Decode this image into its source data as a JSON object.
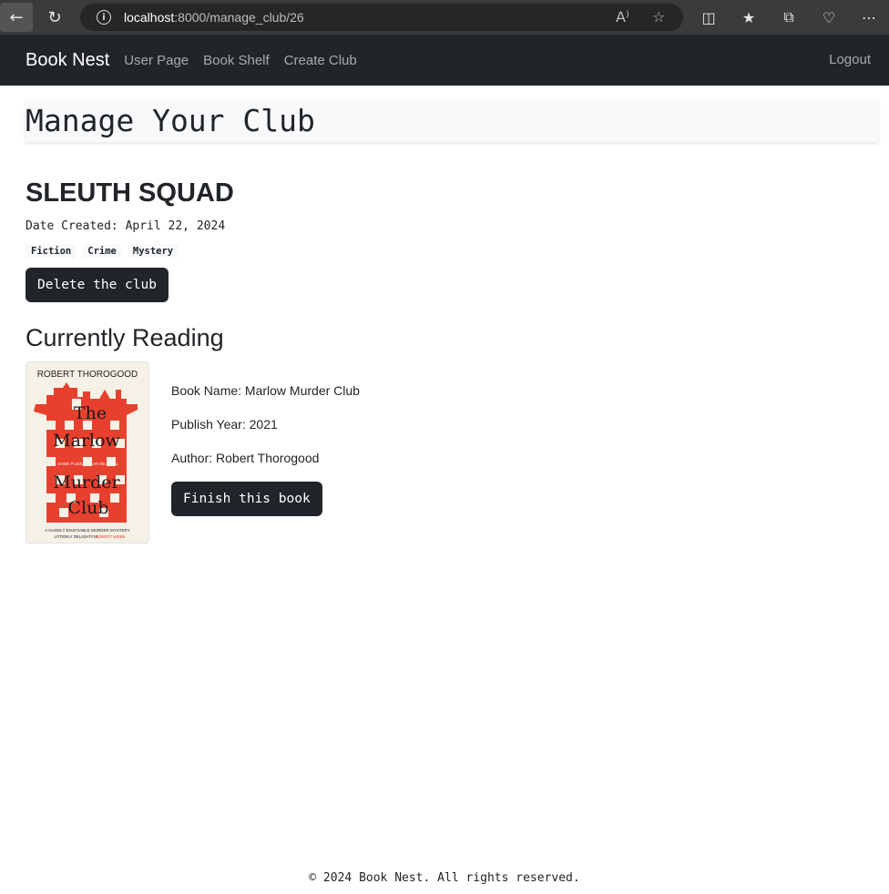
{
  "browser": {
    "url_host": "localhost",
    "url_path": ":8000/manage_club/26"
  },
  "navbar": {
    "brand": "Book Nest",
    "links": [
      "User Page",
      "Book Shelf",
      "Create Club"
    ],
    "logout": "Logout"
  },
  "page": {
    "title": "Manage Your Club"
  },
  "club": {
    "name": "SLEUTH SQUAD",
    "date_created": "Date Created: April 22, 2024",
    "tags": [
      "Fiction",
      "Crime",
      "Mystery"
    ],
    "delete_label": "Delete the club"
  },
  "reading": {
    "section_title": "Currently Reading",
    "book_name": "Book Name: Marlow Murder Club",
    "publish_year": "Publish Year: 2021",
    "author": "Author: Robert Thorogood",
    "finish_label": "Finish this book",
    "cover": {
      "author_line": "ROBERT THOROGOOD",
      "title_words": [
        "The",
        "Marlow",
        "Murder",
        "Club"
      ],
      "tagline": "SOME PUZZLES CAN BE FATAL",
      "blurb": "A HUGELY ENJOYABLE MURDER MYSTERY",
      "blurb2": "UTTERLY DELIGHTFUL",
      "blurb_name": "ROBERT WEBB"
    }
  },
  "footer": {
    "text": "© 2024 Book Nest. All rights reserved."
  },
  "colors": {
    "navbar": "#212529",
    "button": "#212529",
    "cover_red": "#e8402f",
    "cover_cream": "#f6f1e6"
  }
}
